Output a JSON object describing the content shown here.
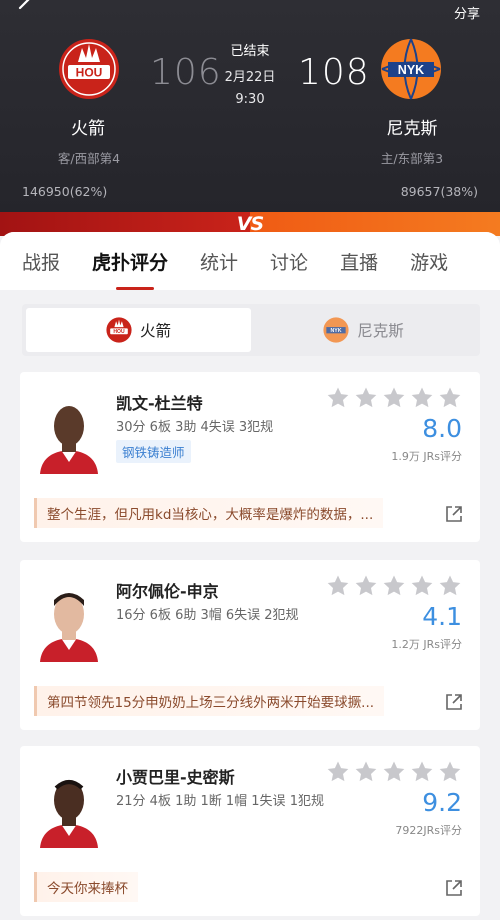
{
  "header": {
    "share_label": "分享"
  },
  "game": {
    "status": "已结束",
    "date": "2月22日",
    "time": "9:30",
    "home": {
      "name": "尼克斯",
      "logo_text": "NYK",
      "score": "108",
      "rank": "主/东部第3",
      "votes": "89657(38%)"
    },
    "away": {
      "name": "火箭",
      "logo_text": "HOU",
      "score": "106",
      "rank": "客/西部第4",
      "votes": "146950(62%)"
    },
    "vs_label": "VS",
    "vote_share": {
      "away": 62,
      "home": 38
    }
  },
  "tabs": [
    {
      "label": "战报"
    },
    {
      "label": "虎扑评分"
    },
    {
      "label": "统计"
    },
    {
      "label": "讨论"
    },
    {
      "label": "直播"
    },
    {
      "label": "游戏"
    }
  ],
  "team_switch": {
    "left": "火箭",
    "right": "尼克斯"
  },
  "players": [
    {
      "name": "凯文-杜兰特",
      "stats": "30分 6板 3助 4失误 3犯规",
      "tag": "钢铁铸造师",
      "rating": "8.0",
      "rating_count": "1.9万 JRs评分",
      "comment": "整个生涯，但凡用kd当核心，大概率是爆炸的数据，..."
    },
    {
      "name": "阿尔佩伦-申京",
      "stats": "16分 6板 6助 3帽 6失误 2犯规",
      "tag": "",
      "rating": "4.1",
      "rating_count": "1.2万 JRs评分",
      "comment": "第四节领先15分申奶奶上场三分线外两米开始要球撅..."
    },
    {
      "name": "小贾巴里-史密斯",
      "stats": "21分 4板 1助 1断 1帽 1失误 1犯规",
      "tag": "",
      "rating": "9.2",
      "rating_count": "7922JRs评分",
      "comment": "今天你来捧杯"
    }
  ],
  "colors": {
    "rockets_red": "#c9231a",
    "knicks_orange": "#f47b20",
    "rating_blue": "#3d8fe0",
    "star_gray": "#c8c8cc"
  },
  "icons": {
    "back": "back-arrow-icon",
    "star": "star-icon",
    "share": "share-external-icon"
  }
}
